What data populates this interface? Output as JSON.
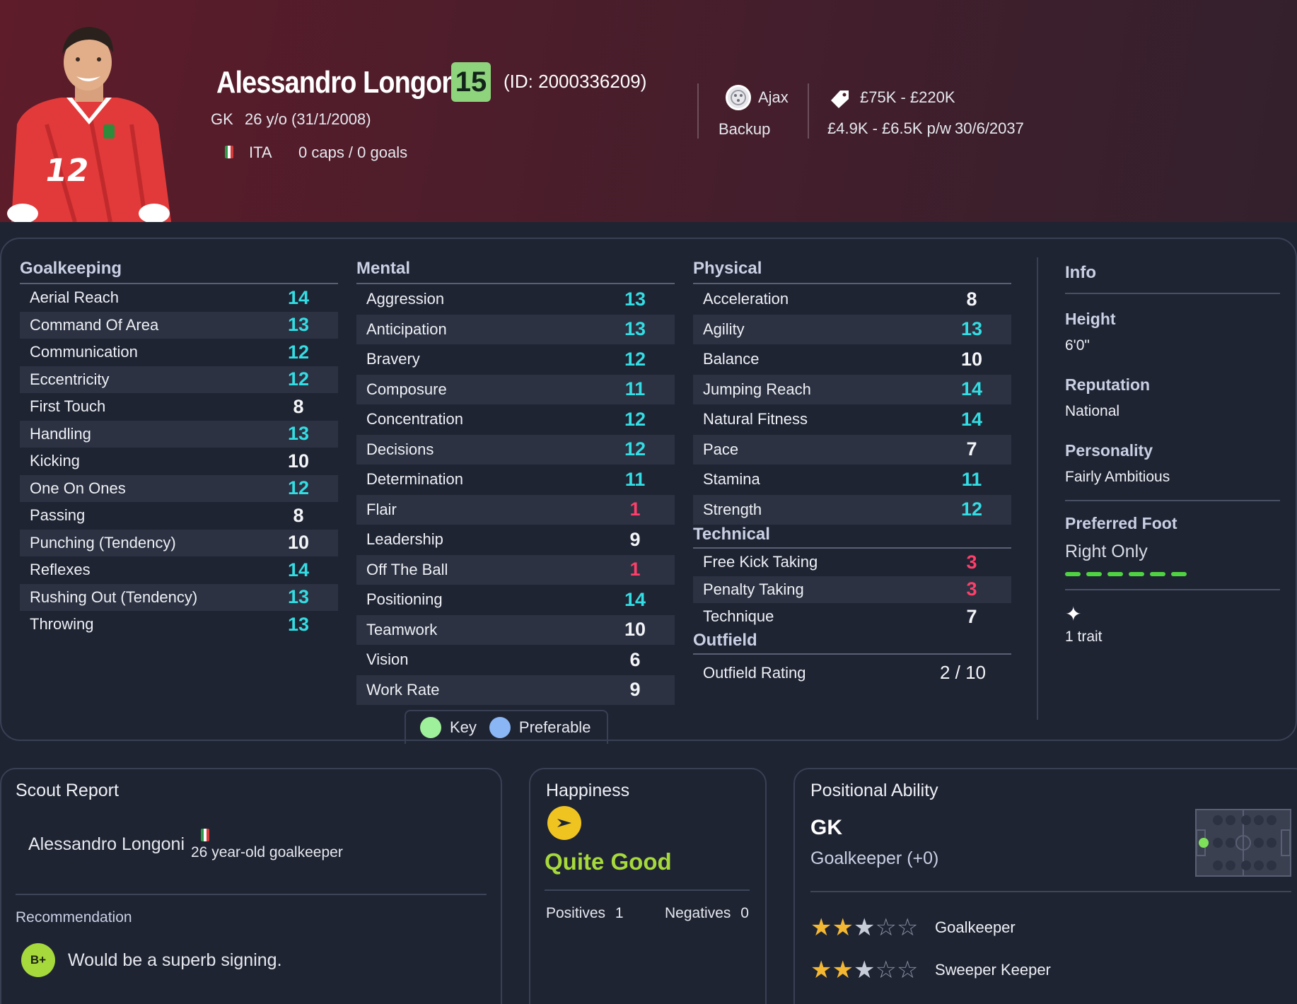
{
  "player": {
    "name": "Alessandro Longoni",
    "ability_badge": "15",
    "id_text": "(ID: 2000336209)",
    "position": "GK",
    "age_dob": "26 y/o (31/1/2008)",
    "nation": "ITA",
    "caps_goals": "0 caps / 0 goals",
    "club": "Ajax",
    "squad_status": "Backup",
    "value_range": "£75K - £220K",
    "wage_range": "£4.9K - £6.5K p/w",
    "contract_end": "30/6/2037"
  },
  "goalkeeping": {
    "title": "Goalkeeping",
    "rows": [
      {
        "label": "Aerial Reach",
        "value": "14",
        "tier": "hi"
      },
      {
        "label": "Command Of Area",
        "value": "13",
        "tier": "hi"
      },
      {
        "label": "Communication",
        "value": "12",
        "tier": "hi"
      },
      {
        "label": "Eccentricity",
        "value": "12",
        "tier": "hi"
      },
      {
        "label": "First Touch",
        "value": "8",
        "tier": "mid"
      },
      {
        "label": "Handling",
        "value": "13",
        "tier": "hi"
      },
      {
        "label": "Kicking",
        "value": "10",
        "tier": "mid"
      },
      {
        "label": "One On Ones",
        "value": "12",
        "tier": "hi"
      },
      {
        "label": "Passing",
        "value": "8",
        "tier": "mid"
      },
      {
        "label": "Punching (Tendency)",
        "value": "10",
        "tier": "mid"
      },
      {
        "label": "Reflexes",
        "value": "14",
        "tier": "hi"
      },
      {
        "label": "Rushing Out (Tendency)",
        "value": "13",
        "tier": "hi"
      },
      {
        "label": "Throwing",
        "value": "13",
        "tier": "hi"
      }
    ]
  },
  "mental": {
    "title": "Mental",
    "rows": [
      {
        "label": "Aggression",
        "value": "13",
        "tier": "hi"
      },
      {
        "label": "Anticipation",
        "value": "13",
        "tier": "hi"
      },
      {
        "label": "Bravery",
        "value": "12",
        "tier": "hi"
      },
      {
        "label": "Composure",
        "value": "11",
        "tier": "hi"
      },
      {
        "label": "Concentration",
        "value": "12",
        "tier": "hi"
      },
      {
        "label": "Decisions",
        "value": "12",
        "tier": "hi"
      },
      {
        "label": "Determination",
        "value": "11",
        "tier": "hi"
      },
      {
        "label": "Flair",
        "value": "1",
        "tier": "lo"
      },
      {
        "label": "Leadership",
        "value": "9",
        "tier": "mid"
      },
      {
        "label": "Off The Ball",
        "value": "1",
        "tier": "lo"
      },
      {
        "label": "Positioning",
        "value": "14",
        "tier": "hi"
      },
      {
        "label": "Teamwork",
        "value": "10",
        "tier": "mid"
      },
      {
        "label": "Vision",
        "value": "6",
        "tier": "mid"
      },
      {
        "label": "Work Rate",
        "value": "9",
        "tier": "mid"
      }
    ]
  },
  "physical": {
    "title": "Physical",
    "rows": [
      {
        "label": "Acceleration",
        "value": "8",
        "tier": "mid"
      },
      {
        "label": "Agility",
        "value": "13",
        "tier": "hi"
      },
      {
        "label": "Balance",
        "value": "10",
        "tier": "mid"
      },
      {
        "label": "Jumping Reach",
        "value": "14",
        "tier": "hi"
      },
      {
        "label": "Natural Fitness",
        "value": "14",
        "tier": "hi"
      },
      {
        "label": "Pace",
        "value": "7",
        "tier": "mid"
      },
      {
        "label": "Stamina",
        "value": "11",
        "tier": "hi"
      },
      {
        "label": "Strength",
        "value": "12",
        "tier": "hi"
      }
    ]
  },
  "technical": {
    "title": "Technical",
    "rows": [
      {
        "label": "Free Kick Taking",
        "value": "3",
        "tier": "lo"
      },
      {
        "label": "Penalty Taking",
        "value": "3",
        "tier": "lo"
      },
      {
        "label": "Technique",
        "value": "7",
        "tier": "mid"
      }
    ]
  },
  "outfield": {
    "title": "Outfield",
    "rating_label": "Outfield Rating",
    "rating_value": "2 / 10"
  },
  "key": {
    "key_label": "Key",
    "preferable_label": "Preferable"
  },
  "info": {
    "title": "Info",
    "height_label": "Height",
    "height_value": "6'0\"",
    "reputation_label": "Reputation",
    "reputation_value": "National",
    "personality_label": "Personality",
    "personality_value": "Fairly Ambitious",
    "foot_label": "Preferred Foot",
    "foot_value": "Right Only",
    "traits_text": "1 trait"
  },
  "scout": {
    "title": "Scout Report",
    "player_name": "Alessandro Longoni",
    "description": "26 year-old goalkeeper",
    "recommendation_label": "Recommendation",
    "grade": "B+",
    "recommendation_text": "Would be a superb signing."
  },
  "happiness": {
    "title": "Happiness",
    "status": "Quite Good",
    "positives_label": "Positives",
    "positives_value": "1",
    "negatives_label": "Negatives",
    "negatives_value": "0"
  },
  "positional": {
    "title": "Positional Ability",
    "position": "GK",
    "role_text": "Goalkeeper (+0)",
    "roles": [
      {
        "name": "Goalkeeper",
        "stars": 2.5
      },
      {
        "name": "Sweeper Keeper",
        "stars": 2.5
      }
    ]
  },
  "colors": {
    "high": "#33dde3",
    "mid": "#f4f5f8",
    "low": "#ff3f6a",
    "badge": "#8ed47c",
    "happiness": "#a6d93b",
    "foot_bar": "#4fd441",
    "star": "#f3b731"
  },
  "icons": [
    "club-crest-icon",
    "price-tag-icon",
    "italy-flag-icon",
    "sparkle-icon",
    "happy-face-icon"
  ]
}
